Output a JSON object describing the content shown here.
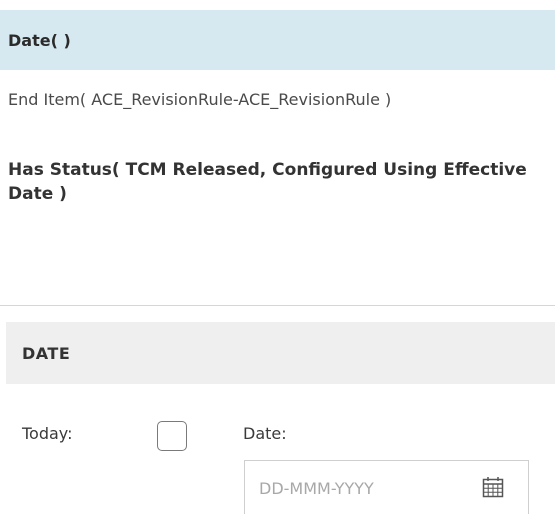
{
  "rules": [
    {
      "text": "Date( )"
    },
    {
      "text": "End Item( ACE_RevisionRule-ACE_RevisionRule )"
    },
    {
      "text": "Has Status( TCM Released, Configured Using Effective Date )"
    }
  ],
  "date_section": {
    "header": "DATE",
    "today_label": "Today:",
    "today_checked": false,
    "date_label": "Date:",
    "date_value": "",
    "date_placeholder": "DD-MMM-YYYY",
    "calendar_icon": "calendar-icon"
  },
  "colors": {
    "selected_row": "#d6e9f0",
    "section_header_bg": "#efefef",
    "divider": "#d6d6d6"
  }
}
